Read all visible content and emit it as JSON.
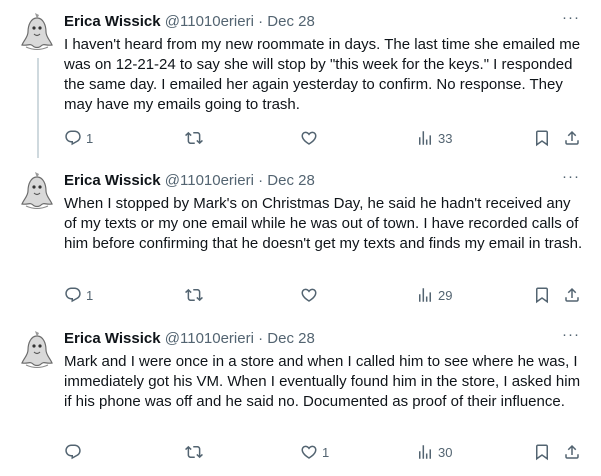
{
  "tweets": [
    {
      "name": "Erica Wissick",
      "handle": "@11010erieri",
      "sep": "·",
      "date": "Dec 28",
      "text": "I haven't heard from my new roommate in days. The last time she emailed me was on 12-21-24 to say she will stop by \"this week for the keys.\" I responded the same day. I emailed her again yesterday to confirm. No response. They may have my emails going to trash.",
      "replies": "1",
      "reposts": "",
      "likes": "",
      "views": "33"
    },
    {
      "name": "Erica Wissick",
      "handle": "@11010erieri",
      "sep": "·",
      "date": "Dec 28",
      "text": "When I stopped by Mark's on Christmas Day, he said he hadn't received any of my texts or my one email while he was out of town. I have recorded calls of him before confirming that he doesn't get my texts and finds my email in trash.",
      "replies": "1",
      "reposts": "",
      "likes": "",
      "views": "29"
    },
    {
      "name": "Erica Wissick",
      "handle": "@11010erieri",
      "sep": "·",
      "date": "Dec 28",
      "text": "Mark and I were once in a store and when I called him to see where he was, I immediately got his VM. When I eventually found him in the store, I asked him if his phone was off and he said no. Documented as proof of their influence.",
      "replies": "",
      "reposts": "",
      "likes": "1",
      "views": "30"
    }
  ],
  "more_glyph": "···",
  "colors": {
    "text": "#0f1419",
    "muted": "#536471",
    "thread_line": "#cfd9de"
  },
  "icons": [
    "avatar-ghost-icon",
    "reply-icon",
    "repost-icon",
    "like-icon",
    "views-icon",
    "bookmark-icon",
    "share-icon",
    "more-icon"
  ]
}
